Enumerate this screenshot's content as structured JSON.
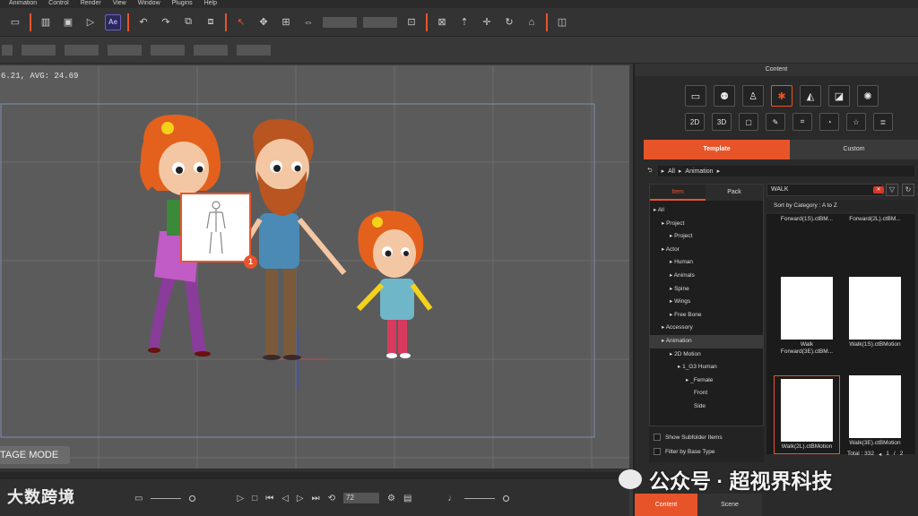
{
  "menu": [
    "Animation",
    "Control",
    "Render",
    "View",
    "Window",
    "Plugins",
    "Help"
  ],
  "toolbar": {
    "ae_label": "Ae"
  },
  "viewport": {
    "fps_text": "6.21, AVG: 24.69",
    "stage_mode": "TAGE MODE",
    "badge": "1"
  },
  "timeline": {
    "frame_value": "72",
    "watermark_left": "大数跨境"
  },
  "panel": {
    "title": "Content",
    "tabs": {
      "template": "Template",
      "custom": "Custom"
    },
    "crumbs": [
      "All",
      "Animation"
    ],
    "tree_tabs": {
      "item": "Item",
      "pack": "Pack"
    },
    "tree": [
      {
        "label": "All",
        "indent": 0
      },
      {
        "label": "Project",
        "indent": 1
      },
      {
        "label": "Project",
        "indent": 2
      },
      {
        "label": "Actor",
        "indent": 1
      },
      {
        "label": "Human",
        "indent": 2
      },
      {
        "label": "Animals",
        "indent": 2
      },
      {
        "label": "Spine",
        "indent": 2
      },
      {
        "label": "Wings",
        "indent": 2
      },
      {
        "label": "Free Bone",
        "indent": 2
      },
      {
        "label": "Accessory",
        "indent": 1
      },
      {
        "label": "Animation",
        "indent": 1
      },
      {
        "label": "2D Motion",
        "indent": 2
      },
      {
        "label": "1_G3 Human",
        "indent": 3
      },
      {
        "label": "_Female",
        "indent": 4
      },
      {
        "label": "Front",
        "indent": 5
      },
      {
        "label": "Side",
        "indent": 5
      }
    ],
    "search_value": "WALK",
    "sort_by": "Sort by Category : A to Z",
    "cards": [
      {
        "label": "Forward(1S).ctBM..."
      },
      {
        "label": "Forward(2L).ctBM..."
      },
      {
        "label": "Walk Forward(3E).ctBM..."
      },
      {
        "label": "Walk(1S).ctBMotion"
      },
      {
        "label": "Walk(2L).ctBMotion"
      },
      {
        "label": "Walk(3E).ctBMotion"
      }
    ],
    "options": {
      "show_subfolder": "Show Subfolder Items",
      "filter_base": "Filter by Base Type"
    },
    "total": "Total : 332",
    "page": "1",
    "page_sep": "/",
    "page_total": "2",
    "bottom_tabs": {
      "content": "Content",
      "scene": "Scene"
    }
  },
  "watermark_right": "公众号 · 超视界科技"
}
